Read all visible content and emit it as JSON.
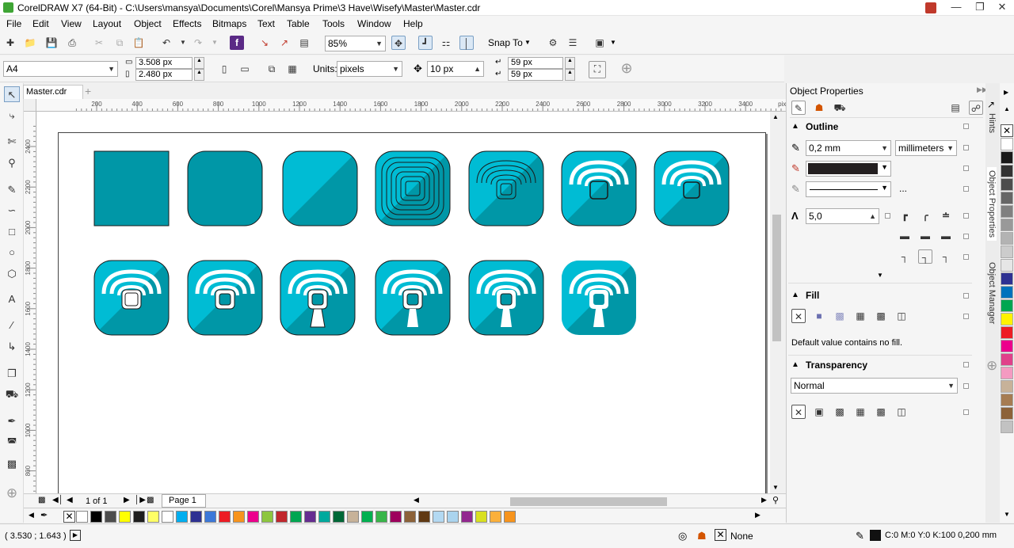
{
  "window": {
    "title": "CorelDRAW X7 (64-Bit) - C:\\Users\\mansya\\Documents\\Corel\\Mansya Prime\\3 Have\\Wisefy\\Master\\Master.cdr"
  },
  "menu": [
    "File",
    "Edit",
    "View",
    "Layout",
    "Object",
    "Effects",
    "Bitmaps",
    "Text",
    "Table",
    "Tools",
    "Window",
    "Help"
  ],
  "standard_toolbar": {
    "zoom": "85%",
    "snap_to": "Snap To"
  },
  "property_bar": {
    "page_size": "A4",
    "width": "3.508 px",
    "height": "2.480 px",
    "units_label": "Units:",
    "units": "pixels",
    "nudge": "10 px",
    "dup_x": "59 px",
    "dup_y": "59 px"
  },
  "doc_tab": {
    "name": "Master.cdr"
  },
  "ruler": {
    "h_ticks": [
      "200",
      "400",
      "600",
      "800",
      "1000",
      "1200",
      "1400",
      "1600",
      "1800",
      "2000",
      "2200",
      "2400",
      "2600",
      "2800",
      "3000",
      "3200",
      "3400",
      "pixels"
    ],
    "v_ticks": [
      "2400",
      "2200",
      "2000",
      "1800",
      "1600",
      "1400",
      "1200",
      "1000",
      "800",
      "pixels"
    ]
  },
  "page_nav": {
    "counter": "1 of 1",
    "page_tab": "Page 1"
  },
  "status": {
    "coords": "( 3.530 ; 1.643 )",
    "fill": "None",
    "outline": "C:0 M:0 Y:0 K:100  0,200 mm"
  },
  "docker": {
    "title": "Object Properties",
    "outline": {
      "heading": "Outline",
      "width": "0,2 mm",
      "units": "millimeters",
      "miter": "5,0",
      "more": "..."
    },
    "fill": {
      "heading": "Fill",
      "note": "Default value contains no fill."
    },
    "transparency": {
      "heading": "Transparency",
      "mode": "Normal"
    }
  },
  "side_tabs": [
    "Hints",
    "Object Properties",
    "Object Manager"
  ],
  "colors": {
    "accent": "#0097a7",
    "accent_light": "#00bcd4",
    "palette": [
      "#ffffff",
      "#000000",
      "#4d4d4d",
      "#ffff00",
      "#1e1e1e",
      "#ffff66",
      "#ffffff",
      "#00aeef",
      "#2e3192",
      "#3c78d8",
      "#ed1c24",
      "#f7941d",
      "#ec008c",
      "#8dc63f",
      "#c1272d",
      "#00a651",
      "#662d91",
      "#00a99d",
      "#006837",
      "#c7b299",
      "#00b050",
      "#39b54a",
      "#9e005d",
      "#8c6239",
      "#603913",
      "#b3d9f2",
      "#aad4ee",
      "#92278f",
      "#d9e021",
      "#fbb03b",
      "#f7941d"
    ],
    "rpal": [
      "#ffffff",
      "#1a1a1a",
      "#333333",
      "#4d4d4d",
      "#666666",
      "#808080",
      "#999999",
      "#b3b3b3",
      "#cccccc",
      "#e6e6e6",
      "#2e3192",
      "#0072bc",
      "#00a651",
      "#fff200",
      "#ed1c24",
      "#ec008c",
      "#e0408a",
      "#f49ac1",
      "#c7b299",
      "#a67c52",
      "#8c6239",
      "#c2c2c2"
    ]
  }
}
